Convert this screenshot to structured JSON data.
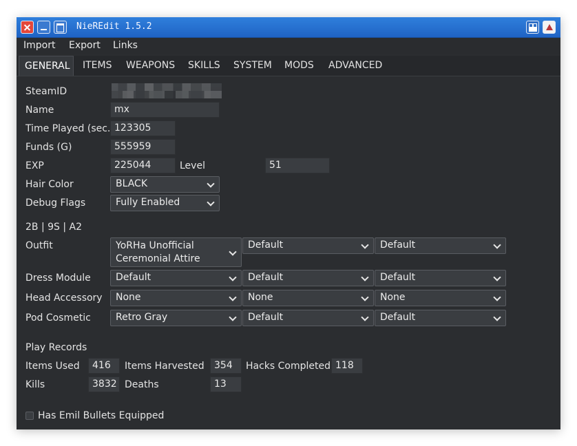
{
  "window": {
    "title": "NieREdit 1.5.2"
  },
  "menu": [
    "Import",
    "Export",
    "Links"
  ],
  "tabs": [
    "GENERAL",
    "ITEMS",
    "WEAPONS",
    "SKILLS",
    "SYSTEM",
    "MODS",
    "ADVANCED"
  ],
  "general": {
    "steamid_label": "SteamID",
    "name_label": "Name",
    "name_value": "mx",
    "time_label": "Time Played (sec.)",
    "time_value": "123305",
    "funds_label": "Funds (G)",
    "funds_value": "555959",
    "exp_label": "EXP",
    "exp_value": "225044",
    "level_label": "Level",
    "level_value": "51",
    "hair_label": "Hair Color",
    "hair_value": "BLACK",
    "debug_label": "Debug Flags",
    "debug_value": "Fully Enabled"
  },
  "characters": {
    "header": "2B | 9S | A2",
    "outfit_label": "Outfit",
    "outfit": [
      "YoRHa Unofficial Ceremonial Attire",
      "Default",
      "Default"
    ],
    "dress_label": "Dress Module",
    "dress": [
      "Default",
      "Default",
      "Default"
    ],
    "head_label": "Head Accessory",
    "head": [
      "None",
      "None",
      "None"
    ],
    "pod_label": "Pod Cosmetic",
    "pod": [
      "Retro Gray",
      "Default",
      "Default"
    ]
  },
  "records": {
    "header": "Play Records",
    "items_used_label": "Items Used",
    "items_used": "416",
    "items_harvested_label": "Items Harvested",
    "items_harvested": "354",
    "hacks_label": "Hacks Completed",
    "hacks": "118",
    "kills_label": "Kills",
    "kills": "3832",
    "deaths_label": "Deaths",
    "deaths": "13"
  },
  "emil": {
    "label": "Has Emil Bullets Equipped",
    "checked": false
  }
}
